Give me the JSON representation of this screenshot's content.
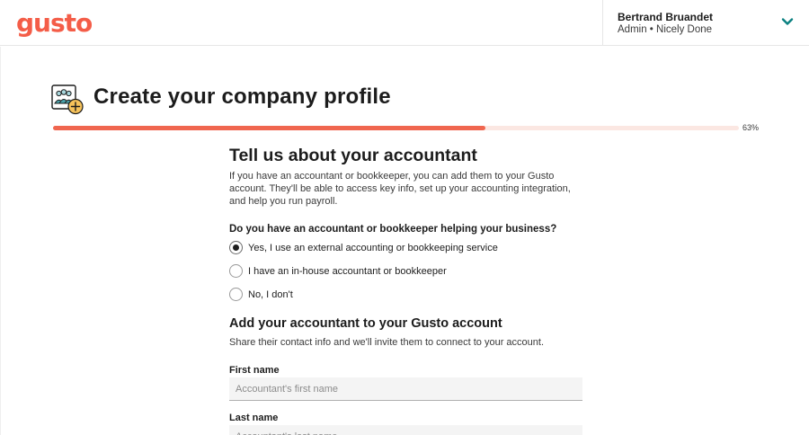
{
  "header": {
    "logo_text": "gusto",
    "user_name": "Bertrand Bruandet",
    "user_role": "Admin • Nicely Done"
  },
  "page": {
    "title": "Create your company profile",
    "progress_percent": 63,
    "progress_label": "63%"
  },
  "accountant_section": {
    "title": "Tell us about your accountant",
    "description": "If you have an accountant or bookkeeper, you can add them to your Gusto account. They'll be able to access key info, set up your accounting integration, and help you run payroll.",
    "question": "Do you have an accountant or bookkeeper helping your business?",
    "options": [
      {
        "label": "Yes, I use an external accounting or bookkeeping service",
        "checked": true
      },
      {
        "label": "I have an in-house accountant or bookkeeper",
        "checked": false
      },
      {
        "label": "No, I don't",
        "checked": false
      }
    ]
  },
  "invite_section": {
    "title": "Add your accountant to your Gusto account",
    "description": "Share their contact info and we'll invite them to connect to your account."
  },
  "fields": {
    "first_name": {
      "label": "First name",
      "placeholder": "Accountant's first name",
      "value": ""
    },
    "last_name": {
      "label": "Last name",
      "placeholder": "Accountant's last name",
      "value": ""
    }
  },
  "colors": {
    "brand": "#f45d48",
    "progress_fill": "#f0664f",
    "progress_track": "#fbe7e2"
  },
  "icons": {
    "company_profile": "people-group-plus-icon",
    "account_menu": "chevron-down-icon"
  }
}
